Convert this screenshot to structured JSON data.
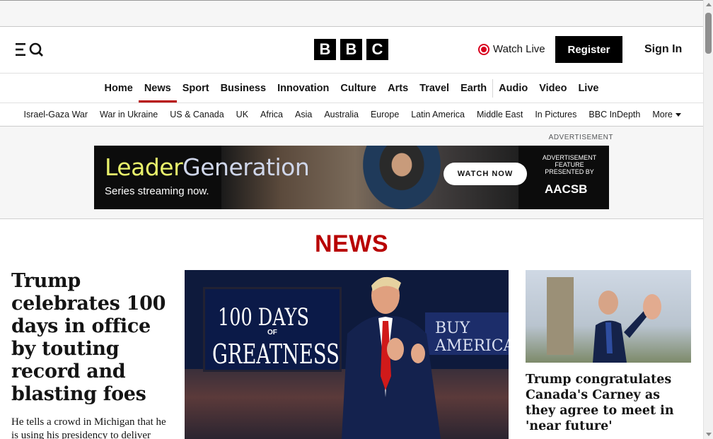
{
  "brand": {
    "logo_letters": [
      "B",
      "B",
      "C"
    ]
  },
  "header": {
    "menu_icon": "menu-search-icon",
    "watch_live_label": "Watch Live",
    "register_label": "Register",
    "sign_in_label": "Sign In"
  },
  "primary_nav": {
    "items": [
      {
        "label": "Home",
        "active": false
      },
      {
        "label": "News",
        "active": true
      },
      {
        "label": "Sport",
        "active": false
      },
      {
        "label": "Business",
        "active": false
      },
      {
        "label": "Innovation",
        "active": false
      },
      {
        "label": "Culture",
        "active": false
      },
      {
        "label": "Arts",
        "active": false
      },
      {
        "label": "Travel",
        "active": false
      },
      {
        "label": "Earth",
        "active": false
      },
      {
        "label": "Audio",
        "active": false
      },
      {
        "label": "Video",
        "active": false
      },
      {
        "label": "Live",
        "active": false
      }
    ]
  },
  "secondary_nav": {
    "items": [
      "Israel-Gaza War",
      "War in Ukraine",
      "US & Canada",
      "UK",
      "Africa",
      "Asia",
      "Australia",
      "Europe",
      "Latin America",
      "Middle East",
      "In Pictures",
      "BBC InDepth"
    ],
    "more_label": "More"
  },
  "advertisement": {
    "label": "ADVERTISEMENT",
    "title_part1": "Leader",
    "title_part2": "Generation",
    "subtitle": "Series streaming now.",
    "cta_label": "WATCH NOW",
    "feature_text": "ADVERTISEMENT FEATURE PRESENTED BY",
    "sponsor": "AACSB"
  },
  "section": {
    "title": "NEWS"
  },
  "lead_story": {
    "headline": "Trump celebrates 100 days in office by touting record and blasting foes",
    "summary": "He tells a crowd in Michigan that he is using his presidency to deliver \"profound change\".",
    "image_sign_line1": "100 DAYS",
    "image_sign_line2": "OF",
    "image_sign_line3": "GREATNESS",
    "image_banner": "BUY AMERICA"
  },
  "side_story": {
    "headline": "Trump congratulates Canada's Carney as they agree to meet in 'near future'"
  },
  "colors": {
    "accent_red": "#b80000",
    "live_red": "#d8001e",
    "black": "#000000"
  }
}
